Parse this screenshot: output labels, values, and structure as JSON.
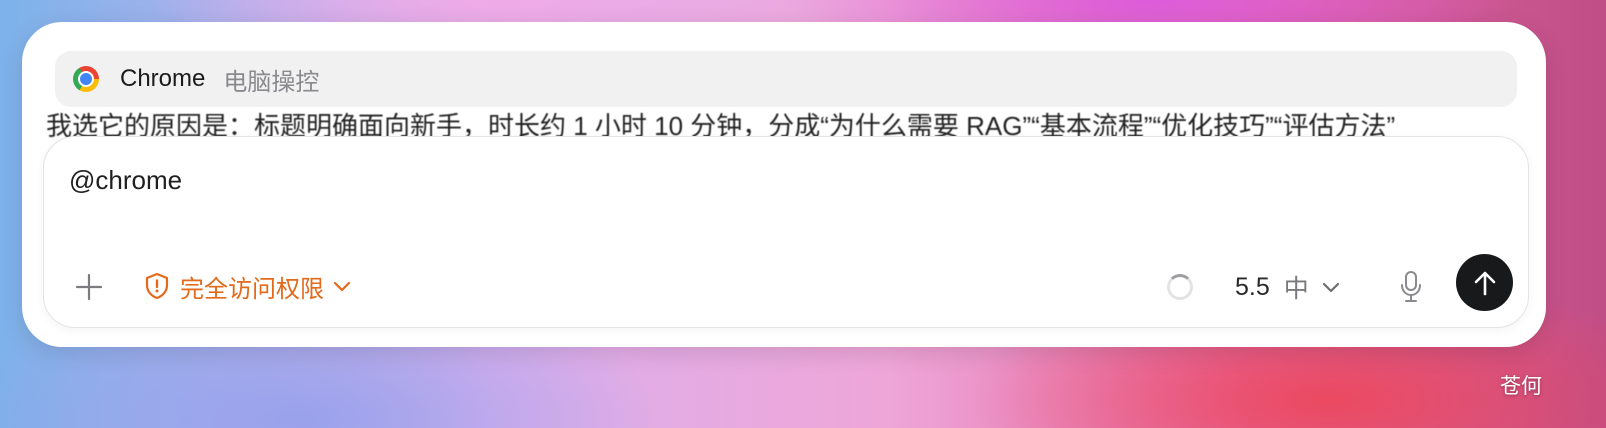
{
  "background_text": "我选它的原因是：标题明确面向新手，时长约 1 小时 10 分钟，分成“为什么需要 RAG”“基本流程”“优化技巧”“评估方法”",
  "suggestion": {
    "app_name": "Chrome",
    "description": "电脑操控",
    "icon": "chrome-logo"
  },
  "composer": {
    "input_value": "@chrome",
    "add_icon": "plus-icon",
    "permission": {
      "label": "完全访问权限",
      "icon": "shield-alert-icon",
      "color": "#e36a1a"
    },
    "model": {
      "version": "5.5",
      "level": "中"
    },
    "mic_icon": "microphone-icon",
    "send_icon": "arrow-up-icon"
  },
  "watermark": "苍何"
}
